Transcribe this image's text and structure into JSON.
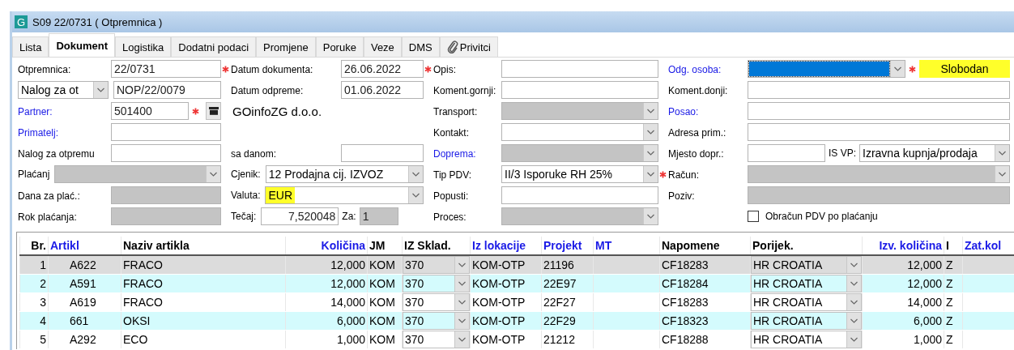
{
  "window": {
    "icon_letter": "G",
    "title": "S09 22/0731  ( Otpremnica )"
  },
  "tabs": [
    {
      "label": "Lista",
      "selected": false,
      "kind": "plain"
    },
    {
      "label": "Dokument",
      "selected": true,
      "kind": "plain"
    },
    {
      "label": "Logistika",
      "selected": false,
      "kind": "plain"
    },
    {
      "label": "Dodatni podaci",
      "selected": false,
      "kind": "plain"
    },
    {
      "label": "Promjene",
      "selected": false,
      "kind": "plain"
    },
    {
      "label": "Poruke",
      "selected": false,
      "kind": "plain"
    },
    {
      "label": "Veze",
      "selected": false,
      "kind": "plain"
    },
    {
      "label": "DMS",
      "selected": false,
      "kind": "plain"
    },
    {
      "label": "Privitci",
      "selected": false,
      "kind": "attachment"
    }
  ],
  "form": {
    "columns": [
      [
        {
          "kind": "pair",
          "label": "Otpremnica:",
          "link": false,
          "required": false,
          "fields": [
            {
              "kind": "input",
              "value": "22/0731",
              "disabled": false
            }
          ]
        },
        {
          "kind": "select-label",
          "label": "Nalog za ot",
          "required": false,
          "fields": [
            {
              "kind": "input",
              "value": "NOP/22/0079",
              "disabled": false
            }
          ]
        },
        {
          "kind": "pair",
          "label": "Partner:",
          "link": true,
          "required": false,
          "fields": [
            {
              "kind": "input",
              "value": "501400",
              "disabled": false,
              "required": true
            },
            {
              "kind": "button"
            }
          ]
        },
        {
          "kind": "pair",
          "label": "Primatelj:",
          "link": true,
          "required": false,
          "fields": [
            {
              "kind": "input",
              "disabled": false
            }
          ]
        },
        {
          "kind": "pair",
          "label": "Nalog za otpremu",
          "link": false,
          "required": false,
          "fields": [
            {
              "kind": "input",
              "disabled": false
            }
          ]
        },
        {
          "kind": "inline",
          "label": "Plaćanj",
          "link": false,
          "required": false,
          "fields": [
            {
              "kind": "select",
              "disabled": true
            }
          ]
        },
        {
          "kind": "pair",
          "label": "Dana za plać.:",
          "link": false,
          "required": false,
          "fields": [
            {
              "kind": "input",
              "disabled": true
            }
          ]
        },
        {
          "kind": "pair",
          "label": "Rok plaćanja:",
          "link": false,
          "required": false,
          "fields": [
            {
              "kind": "input",
              "disabled": true
            }
          ]
        }
      ],
      [
        {
          "kind": "pair",
          "label": "Datum dokumenta:",
          "link": false,
          "required": true,
          "fields": [
            {
              "kind": "input",
              "value": "26.06.2022",
              "disabled": false
            }
          ]
        },
        {
          "kind": "pair",
          "label": "Datum odpreme:",
          "link": false,
          "required": false,
          "fields": [
            {
              "kind": "input",
              "value": "01.06.2022",
              "disabled": false
            }
          ]
        },
        {
          "kind": "free",
          "fields": [
            {
              "kind": "text",
              "value": "GOinfoZG d.o.o."
            }
          ]
        },
        {
          "kind": "blank"
        },
        {
          "kind": "pair",
          "label": "sa danom:",
          "link": false,
          "required": false,
          "fields": [
            {
              "kind": "input",
              "disabled": false
            }
          ]
        },
        {
          "kind": "inline",
          "label": "Cjenik:",
          "link": false,
          "required": false,
          "fields": [
            {
              "kind": "select",
              "value": "12 Prodajna cij. IZVOZ",
              "disabled": false
            }
          ]
        },
        {
          "kind": "inline",
          "label": "Valuta:",
          "link": false,
          "required": false,
          "fields": [
            {
              "kind": "select",
              "value": "EUR",
              "disabled": false,
              "highlight": true
            }
          ]
        },
        {
          "kind": "inline",
          "label": "Tečaj:",
          "link": false,
          "required": false,
          "fields": [
            {
              "kind": "number",
              "value": "7,520048",
              "disabled": false
            },
            {
              "kind": "label",
              "value": "Za:"
            },
            {
              "kind": "input",
              "value": "1",
              "disabled": true
            }
          ]
        }
      ],
      [
        {
          "kind": "pair",
          "label": "Opis:",
          "link": false,
          "required": true,
          "fields": [
            {
              "kind": "input",
              "disabled": false
            }
          ]
        },
        {
          "kind": "pair",
          "label": "Koment.gornji:",
          "link": false,
          "required": false,
          "fields": [
            {
              "kind": "input",
              "disabled": false
            }
          ]
        },
        {
          "kind": "pair",
          "label": "Transport:",
          "link": false,
          "required": false,
          "fields": [
            {
              "kind": "select",
              "disabled": true
            }
          ]
        },
        {
          "kind": "pair",
          "label": "Kontakt:",
          "link": false,
          "required": false,
          "fields": [
            {
              "kind": "select",
              "disabled": false
            }
          ]
        },
        {
          "kind": "pair",
          "label": "Doprema:",
          "link": true,
          "required": false,
          "fields": [
            {
              "kind": "select",
              "disabled": true
            }
          ]
        },
        {
          "kind": "pair",
          "label": "Tip PDV:",
          "link": false,
          "required": false,
          "fields": [
            {
              "kind": "select",
              "value": "II/3 Isporuke RH 25%",
              "disabled": false
            }
          ]
        },
        {
          "kind": "pair",
          "label": "Popusti:",
          "link": false,
          "required": false,
          "fields": [
            {
              "kind": "input",
              "disabled": false
            }
          ]
        },
        {
          "kind": "pair",
          "label": "Proces:",
          "link": false,
          "required": false,
          "fields": [
            {
              "kind": "select",
              "disabled": true
            }
          ]
        }
      ],
      [
        {
          "kind": "pair",
          "label": "Odg. osoba:",
          "link": true,
          "required": false,
          "fields": [
            {
              "kind": "select",
              "disabled": false,
              "focused": true,
              "required": true
            },
            {
              "kind": "status",
              "value": "Slobodan",
              "highlight": true
            }
          ]
        },
        {
          "kind": "pair",
          "label": "Koment.donji:",
          "link": false,
          "required": false,
          "fields": [
            {
              "kind": "input",
              "disabled": false
            }
          ]
        },
        {
          "kind": "pair",
          "label": "Posao:",
          "link": true,
          "required": false,
          "fields": [
            {
              "kind": "input",
              "disabled": false
            }
          ]
        },
        {
          "kind": "pair",
          "label": "Adresa prim.:",
          "link": false,
          "required": false,
          "fields": [
            {
              "kind": "input",
              "disabled": false
            }
          ]
        },
        {
          "kind": "pair",
          "label": "Mjesto dopr.:",
          "link": false,
          "required": false,
          "fields": [
            {
              "kind": "input",
              "disabled": false
            },
            {
              "kind": "label",
              "value": "IS VP:"
            },
            {
              "kind": "select",
              "value": "Izravna kupnja/prodaja",
              "disabled": false
            }
          ]
        },
        {
          "kind": "pair",
          "label": "Račun:",
          "link": false,
          "required": true,
          "fields": [
            {
              "kind": "select",
              "disabled": true
            }
          ]
        },
        {
          "kind": "pair",
          "label": "Poziv:",
          "link": false,
          "required": false,
          "fields": [
            {
              "kind": "input",
              "disabled": true
            }
          ]
        },
        {
          "kind": "pair",
          "fields": [
            {
              "kind": "checkbox",
              "value": "Obračun PDV po plaćanju",
              "checked": false
            }
          ]
        }
      ]
    ]
  },
  "table": {
    "columns": [
      {
        "label": "Br.",
        "link": false,
        "kind": "index"
      },
      {
        "label": "Artikl",
        "link": true,
        "kind": "code"
      },
      {
        "label": "Naziv artikla",
        "link": false,
        "kind": "text"
      },
      {
        "label": "Količina",
        "link": true,
        "kind": "number"
      },
      {
        "label": "JM",
        "link": false,
        "kind": "text"
      },
      {
        "label": "IZ Sklad.",
        "link": false,
        "kind": "select"
      },
      {
        "label": "Iz lokacije",
        "link": true,
        "kind": "text"
      },
      {
        "label": "Projekt",
        "link": true,
        "kind": "text"
      },
      {
        "label": "MT",
        "link": true,
        "kind": "text"
      },
      {
        "label": "Napomene",
        "link": false,
        "kind": "text"
      },
      {
        "label": "Porijek.",
        "link": false,
        "kind": "select"
      },
      {
        "label": "Izv. količina",
        "link": true,
        "kind": "number"
      },
      {
        "label": "I",
        "link": false,
        "kind": "text"
      },
      {
        "label": "Zat.kol",
        "link": true,
        "kind": "text"
      }
    ],
    "rows": [
      {
        "selected": true,
        "cells": [
          "1",
          "A622",
          "FRACO",
          "12,000",
          "KOM",
          "370",
          "KOM-OTP",
          "21196",
          null,
          "CF18283",
          "HR CROATIA",
          "12,000",
          "Z",
          null
        ]
      },
      {
        "selected": false,
        "cells": [
          "2",
          "A591",
          "FRACO",
          "12,000",
          "KOM",
          "370",
          "KOM-OTP",
          "22E97",
          null,
          "CF18284",
          "HR CROATIA",
          "12,000",
          "Z",
          null
        ]
      },
      {
        "selected": false,
        "cells": [
          "3",
          "A619",
          "FRACO",
          "14,000",
          "KOM",
          "370",
          "KOM-OTP",
          "22F27",
          null,
          "CF18283",
          "HR CROATIA",
          "14,000",
          "Z",
          null
        ]
      },
      {
        "selected": false,
        "cells": [
          "4",
          "661",
          "OKSI",
          "6,000",
          "KOM",
          "370",
          "KOM-OTP",
          "22F29",
          null,
          "CF18323",
          "HR CROATIA",
          "6,000",
          "Z",
          null
        ]
      },
      {
        "selected": false,
        "cells": [
          "5",
          "A292",
          "ECO",
          "1,000",
          "KOM",
          "370",
          "KOM-OTP",
          "21212",
          null,
          "CF18288",
          "HR CROATIA",
          "1,000",
          "Z",
          null
        ]
      }
    ]
  }
}
